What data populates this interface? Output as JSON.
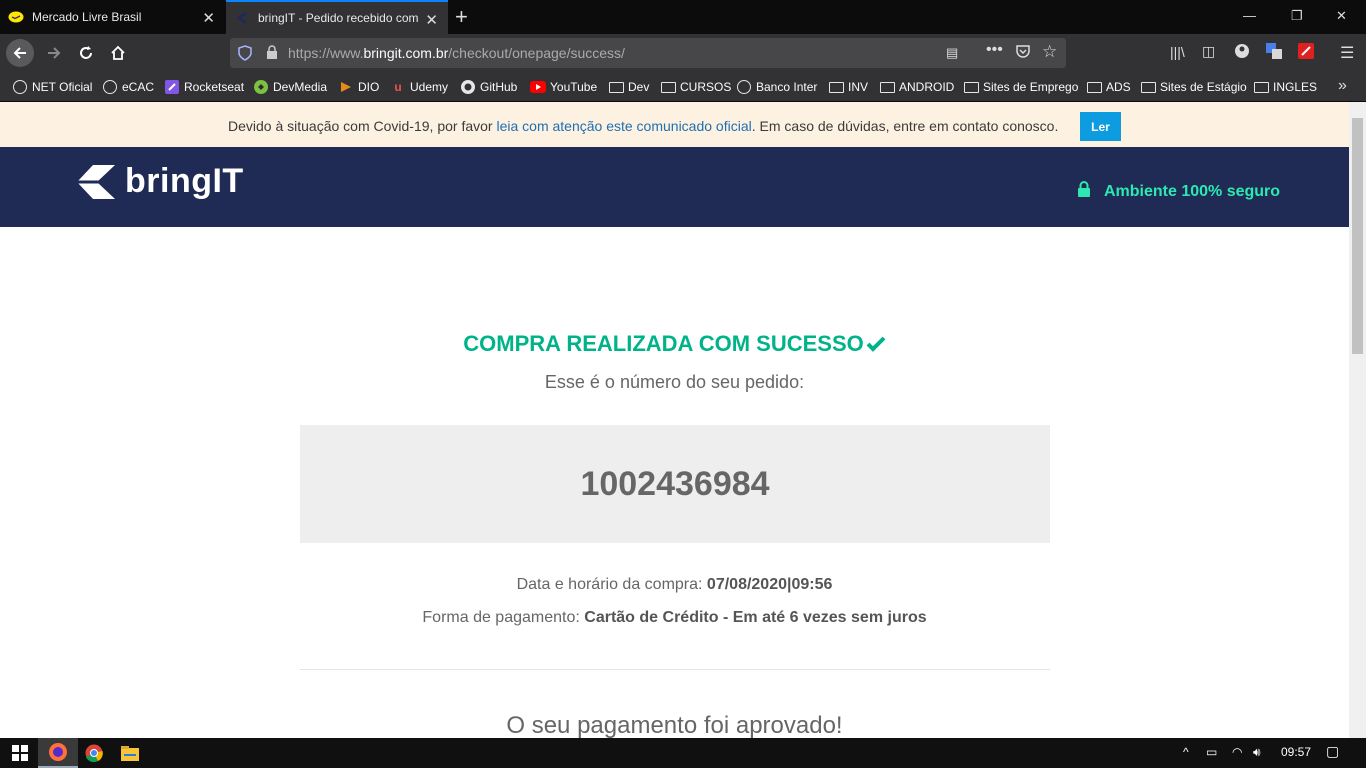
{
  "browser": {
    "tabs": [
      {
        "title": "Mercado Livre Brasil",
        "icon": "mercado-livre-icon"
      },
      {
        "title": "bringIT - Pedido recebido com",
        "icon": "bringit-icon"
      }
    ],
    "url": {
      "scheme": "https://www.",
      "domain": "bringit.com.br",
      "path": "/checkout/onepage/success/"
    },
    "bookmarks": [
      {
        "label": "NET Oficial",
        "icon": "globe-icon"
      },
      {
        "label": "eCAC",
        "icon": "globe-icon"
      },
      {
        "label": "Rocketseat",
        "icon": "rocketseat-icon"
      },
      {
        "label": "DevMedia",
        "icon": "devmedia-icon"
      },
      {
        "label": "DIO",
        "icon": "dio-icon"
      },
      {
        "label": "Udemy",
        "icon": "udemy-icon"
      },
      {
        "label": "GitHub",
        "icon": "github-icon"
      },
      {
        "label": "YouTube",
        "icon": "youtube-icon"
      },
      {
        "label": "Dev",
        "icon": "folder-icon"
      },
      {
        "label": "CURSOS",
        "icon": "folder-icon"
      },
      {
        "label": "Banco Inter",
        "icon": "globe-icon"
      },
      {
        "label": "INV",
        "icon": "folder-icon"
      },
      {
        "label": "ANDROID",
        "icon": "folder-icon"
      },
      {
        "label": "Sites de Emprego",
        "icon": "folder-icon"
      },
      {
        "label": "ADS",
        "icon": "folder-icon"
      },
      {
        "label": "Sites de Estágio",
        "icon": "folder-icon"
      },
      {
        "label": "INGLES",
        "icon": "folder-icon"
      }
    ]
  },
  "notice": {
    "before": "Devido à situação com Covid-19, por favor ",
    "link": "leia com atenção este comunicado oficial",
    "after": ". Em caso de dúvidas, entre em contato conosco.",
    "button": "Ler"
  },
  "header": {
    "logo": "bringIT",
    "secure_label": "Ambiente 100% seguro"
  },
  "order": {
    "success_title": "COMPRA REALIZADA COM SUCESSO",
    "subtitle": "Esse é o número do seu pedido:",
    "number": "1002436984",
    "date_label": "Data e horário da compra: ",
    "date_value": "07/08/2020|09:56",
    "payment_label": "Forma de pagamento: ",
    "payment_value": "Cartão de Crédito - Em até 6 vezes sem juros",
    "approved": "O seu pagamento foi aprovado!"
  },
  "taskbar": {
    "time": "09:57"
  },
  "colors": {
    "accent_green": "#00b388",
    "header_bg": "#1f2a55",
    "secure_green": "#2de8b0",
    "notice_bg": "#fdf2e1",
    "button_blue": "#0d9ce0"
  }
}
